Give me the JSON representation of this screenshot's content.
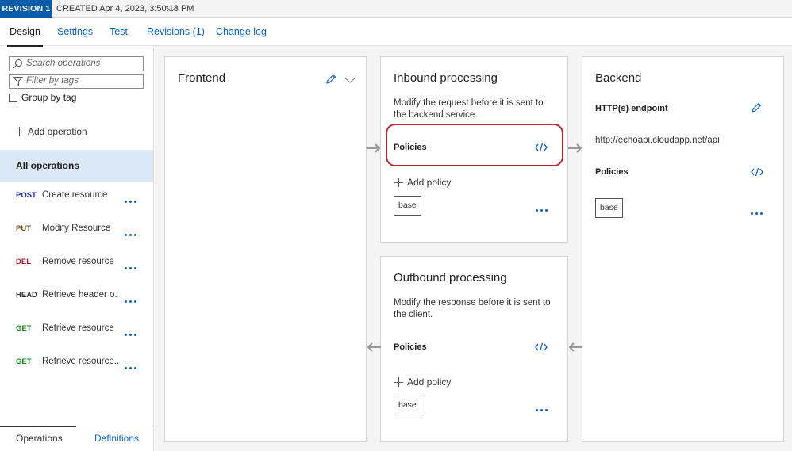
{
  "revision": {
    "badge": "REVISION 1",
    "created": "CREATED Apr 4, 2023, 3:50:13 PM"
  },
  "tabs": [
    {
      "label": "Design"
    },
    {
      "label": "Settings"
    },
    {
      "label": "Test"
    },
    {
      "label": "Revisions (1)"
    },
    {
      "label": "Change log"
    }
  ],
  "left": {
    "search_placeholder": "Search operations",
    "filter_placeholder": "Filter by tags",
    "group_by_tag": "Group by tag",
    "add_operation": "Add operation",
    "all_operations": "All operations",
    "operations": [
      {
        "verb": "POST",
        "name": "Create resource",
        "color": "#1a2aa0"
      },
      {
        "verb": "PUT",
        "name": "Modify Resource",
        "color": "#7a4a1f"
      },
      {
        "verb": "DEL",
        "name": "Remove resource",
        "color": "#a8192b"
      },
      {
        "verb": "HEAD",
        "name": "Retrieve header o...",
        "color": "#333333"
      },
      {
        "verb": "GET",
        "name": "Retrieve resource",
        "color": "#17841e"
      },
      {
        "verb": "GET",
        "name": "Retrieve resource...",
        "color": "#17841e"
      }
    ],
    "bottom_tabs": [
      "Operations",
      "Definitions"
    ]
  },
  "frontend": {
    "title": "Frontend"
  },
  "inbound": {
    "title": "Inbound processing",
    "description": "Modify the request before it is sent to the backend service.",
    "policies_label": "Policies",
    "add_policy": "Add policy",
    "base": "base"
  },
  "outbound": {
    "title": "Outbound processing",
    "description": "Modify the response before it is sent to the client.",
    "policies_label": "Policies",
    "add_policy": "Add policy",
    "base": "base"
  },
  "backend": {
    "title": "Backend",
    "endpoint_label": "HTTP(s) endpoint",
    "endpoint_url": "http://echoapi.cloudapp.net/api",
    "policies_label": "Policies",
    "base": "base"
  },
  "colors": {
    "accent": "#0a63c4",
    "badge": "#0a5ba8",
    "selected": "#dbe8f5",
    "highlight": "#c0232c"
  }
}
